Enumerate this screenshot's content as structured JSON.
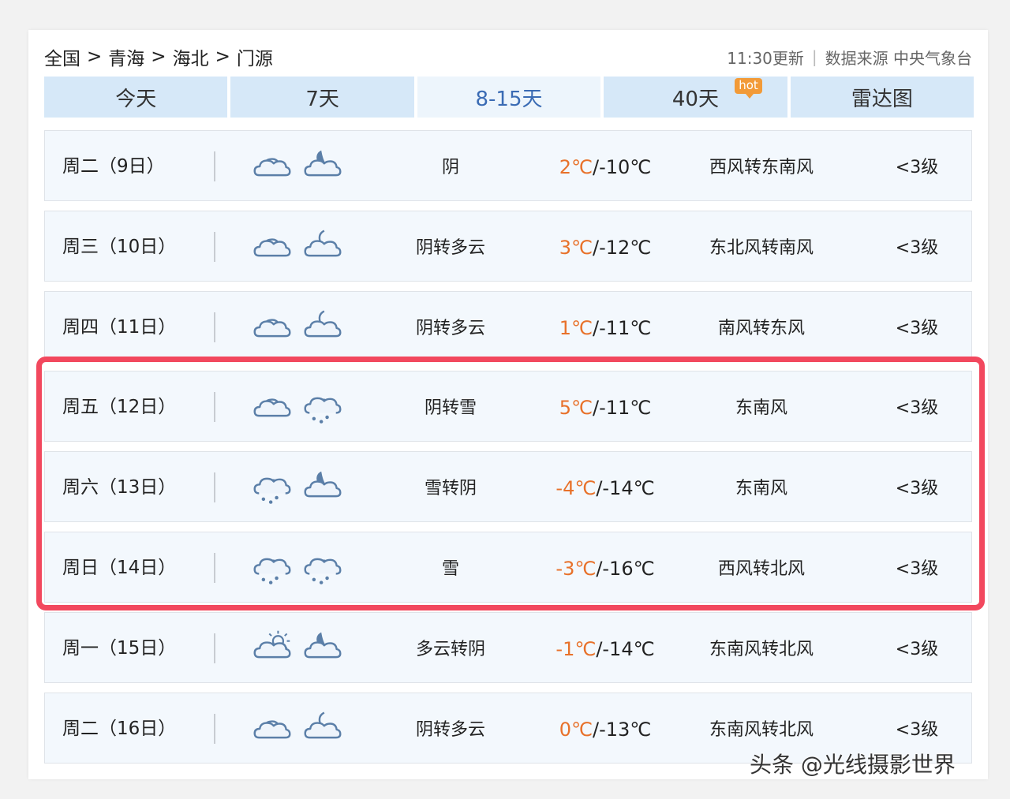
{
  "breadcrumb": [
    "全国",
    "青海",
    "海北",
    "门源"
  ],
  "breadcrumb_sep": ">",
  "update_time": "11:30更新",
  "source_label": "数据来源 中央气象台",
  "tabs": [
    {
      "label": "今天"
    },
    {
      "label": "7天"
    },
    {
      "label": "8-15天"
    },
    {
      "label": "40天"
    },
    {
      "label": "雷达图"
    }
  ],
  "hot_badge": "hot",
  "active_tab_index": 2,
  "rows": [
    {
      "day": "周二（9日）",
      "icon_day": "overcast-cloud-icon",
      "icon_night": "cloudy-night-icon",
      "desc": "阴",
      "hi": "2℃",
      "lo": "/-10℃",
      "wind": "西风转东南风",
      "level": "<3级"
    },
    {
      "day": "周三（10日）",
      "icon_day": "overcast-cloud-icon",
      "icon_night": "partly-cloudy-night-icon",
      "desc": "阴转多云",
      "hi": "3℃",
      "lo": "/-12℃",
      "wind": "东北风转南风",
      "level": "<3级"
    },
    {
      "day": "周四（11日）",
      "icon_day": "overcast-cloud-icon",
      "icon_night": "partly-cloudy-night-icon",
      "desc": "阴转多云",
      "hi": "1℃",
      "lo": "/-11℃",
      "wind": "南风转东风",
      "level": "<3级"
    },
    {
      "day": "周五（12日）",
      "icon_day": "overcast-cloud-icon",
      "icon_night": "snow-icon",
      "desc": "阴转雪",
      "hi": "5℃",
      "lo": "/-11℃",
      "wind": "东南风",
      "level": "<3级"
    },
    {
      "day": "周六（13日）",
      "icon_day": "snow-icon",
      "icon_night": "cloudy-night-icon",
      "desc": "雪转阴",
      "hi": "-4℃",
      "lo": "/-14℃",
      "wind": "东南风",
      "level": "<3级"
    },
    {
      "day": "周日（14日）",
      "icon_day": "snow-icon",
      "icon_night": "snow-icon",
      "desc": "雪",
      "hi": "-3℃",
      "lo": "/-16℃",
      "wind": "西风转北风",
      "level": "<3级"
    },
    {
      "day": "周一（15日）",
      "icon_day": "partly-cloudy-day-icon",
      "icon_night": "cloudy-night-icon",
      "desc": "多云转阴",
      "hi": "-1℃",
      "lo": "/-14℃",
      "wind": "东南风转北风",
      "level": "<3级"
    },
    {
      "day": "周二（16日）",
      "icon_day": "overcast-cloud-icon",
      "icon_night": "partly-cloudy-night-icon",
      "desc": "阴转多云",
      "hi": "0℃",
      "lo": "/-13℃",
      "wind": "东南风转北风",
      "level": "<3级"
    }
  ],
  "colors": {
    "high_temp": "#e8712a",
    "tab_bg": "#d6e8f8",
    "tab_active_text": "#3a6bb4",
    "highlight_border": "#f2485e",
    "icon_stroke": "#5b7fa8"
  },
  "watermark": "头条 @光线摄影世界"
}
